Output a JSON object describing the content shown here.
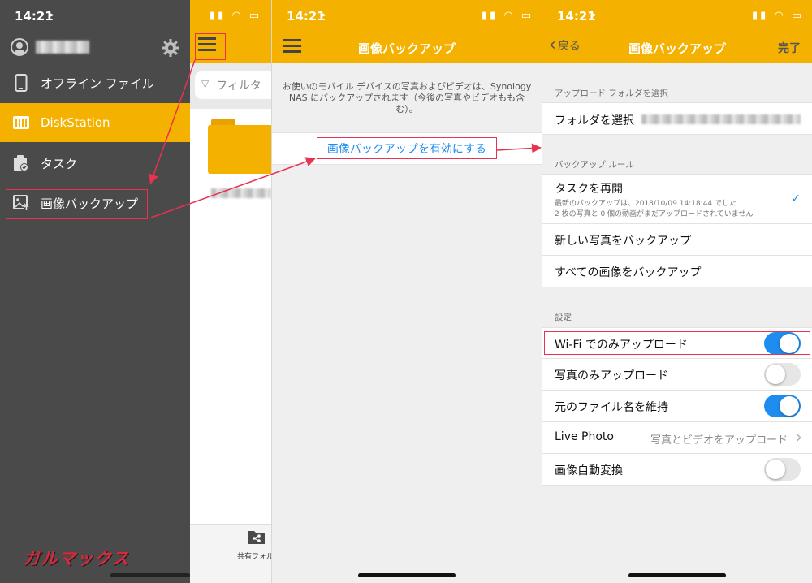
{
  "status": {
    "time": "14:21"
  },
  "drawer": {
    "items": [
      {
        "label": "オフライン ファイル",
        "icon": "phone-icon"
      },
      {
        "label": "DiskStation",
        "icon": "diskstation-icon",
        "active": true
      },
      {
        "label": "タスク",
        "icon": "task-icon"
      },
      {
        "label": "画像バックアップ",
        "icon": "photo-backup-icon"
      }
    ]
  },
  "behind": {
    "filter_placeholder": "フィルタ",
    "share_tab_label": "共有フォル"
  },
  "watermark": "ガルマックス",
  "panel2": {
    "title": "画像バックアップ",
    "description": "お使いのモバイル デバイスの写真およびビデオは、Synology NAS にバックアップされます（今後の写真やビデオもも含む）。",
    "enable_button": "画像バックアップを有効にする"
  },
  "panel3": {
    "back_label": "戻る",
    "title": "画像バックアップ",
    "done_label": "完了",
    "upload_folder_header": "アップロード フォルダを選択",
    "folder_row_label": "フォルダを選択",
    "backup_rule_header": "バックアップ ルール",
    "resume": {
      "label": "タスクを再開",
      "detail_line1": "最新のバックアップは、2018/10/09 14:18:44 でした",
      "detail_line2": "2 枚の写真と 0 個の動画がまだアップロードされていません"
    },
    "new_photos_label": "新しい写真をバックアップ",
    "all_images_label": "すべての画像をバックアップ",
    "settings_header": "設定",
    "settings": [
      {
        "label": "Wi-Fi でのみアップロード",
        "on": true
      },
      {
        "label": "写真のみアップロード",
        "on": false
      },
      {
        "label": "元のファイル名を維持",
        "on": true
      }
    ],
    "live_photo": {
      "label": "Live Photo",
      "value": "写真とビデオをアップロード"
    },
    "auto_convert": {
      "label": "画像自動変換",
      "on": false
    }
  },
  "colors": {
    "accent": "#f5b100",
    "drawer_bg": "#4a4a4a",
    "link": "#1f8cf0",
    "annotation": "#e8324f"
  }
}
